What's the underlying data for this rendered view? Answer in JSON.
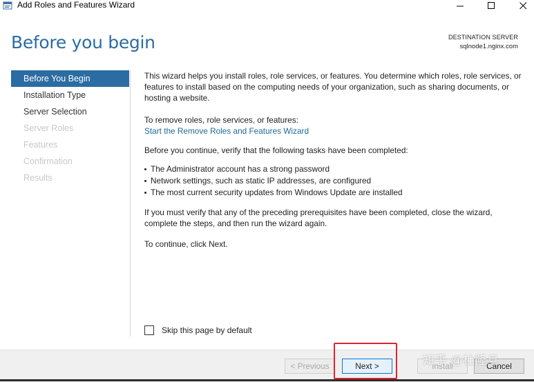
{
  "window": {
    "title": "Add Roles and Features Wizard",
    "icon": "server-manager-icon"
  },
  "header": {
    "page_title": "Before you begin",
    "destination_label": "DESTINATION SERVER",
    "destination_server": "sqlnode1.nginx.com"
  },
  "nav": {
    "items": [
      {
        "label": "Before You Begin",
        "state": "active"
      },
      {
        "label": "Installation Type",
        "state": "enabled"
      },
      {
        "label": "Server Selection",
        "state": "enabled"
      },
      {
        "label": "Server Roles",
        "state": "disabled"
      },
      {
        "label": "Features",
        "state": "disabled"
      },
      {
        "label": "Confirmation",
        "state": "disabled"
      },
      {
        "label": "Results",
        "state": "disabled"
      }
    ]
  },
  "main": {
    "intro": "This wizard helps you install roles, role services, or features. You determine which roles, role services, or features to install based on the computing needs of your organization, such as sharing documents, or hosting a website.",
    "remove_prompt": "To remove roles, role services, or features:",
    "remove_link": "Start the Remove Roles and Features Wizard",
    "verify_prompt": "Before you continue, verify that the following tasks have been completed:",
    "bullets": [
      "The Administrator account has a strong password",
      "Network settings, such as static IP addresses, are configured",
      "The most current security updates from Windows Update are installed"
    ],
    "prereq_note": "If you must verify that any of the preceding prerequisites have been completed, close the wizard, complete the steps, and then run the wizard again.",
    "continue_note": "To continue, click Next."
  },
  "skip": {
    "label": "Skip this page by default",
    "checked": false
  },
  "footer": {
    "previous_label": "< Previous",
    "next_label": "Next >",
    "install_label": "Install",
    "cancel_label": "Cancel"
  },
  "watermark": {
    "text": "知乎 @杜隆旦"
  },
  "colors": {
    "accent": "#2b6ca3",
    "link": "#1c6b9b",
    "highlight": "#e0232f"
  }
}
